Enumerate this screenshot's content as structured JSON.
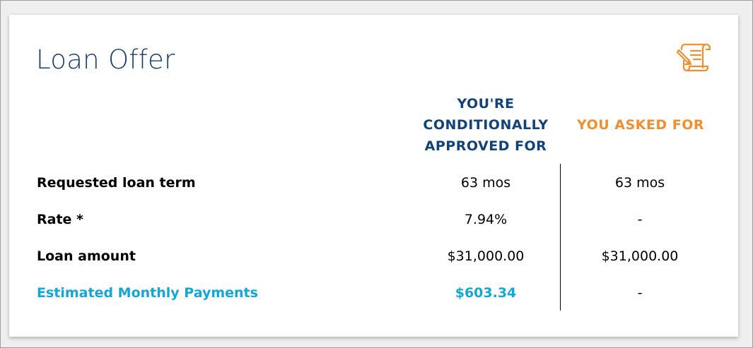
{
  "card": {
    "title": "Loan Offer",
    "icon": "contract-scroll-icon"
  },
  "columns": {
    "approved_header": "YOU'RE CONDITIONALLY APPROVED FOR",
    "asked_header": "YOU ASKED FOR"
  },
  "colors": {
    "title": "#1a3f6f",
    "approved_header": "#12427a",
    "asked_header": "#f08f30",
    "icon": "#f08f30",
    "highlight": "#13a6d6"
  },
  "rows": [
    {
      "label": "Requested loan term",
      "approved": "63 mos",
      "asked": "63 mos"
    },
    {
      "label": "Rate *",
      "approved": "7.94%",
      "asked": "-"
    },
    {
      "label": "Loan amount",
      "approved": "$31,000.00",
      "asked": "$31,000.00"
    },
    {
      "label": "Estimated Monthly Payments",
      "approved": "$603.34",
      "asked": "-"
    }
  ]
}
